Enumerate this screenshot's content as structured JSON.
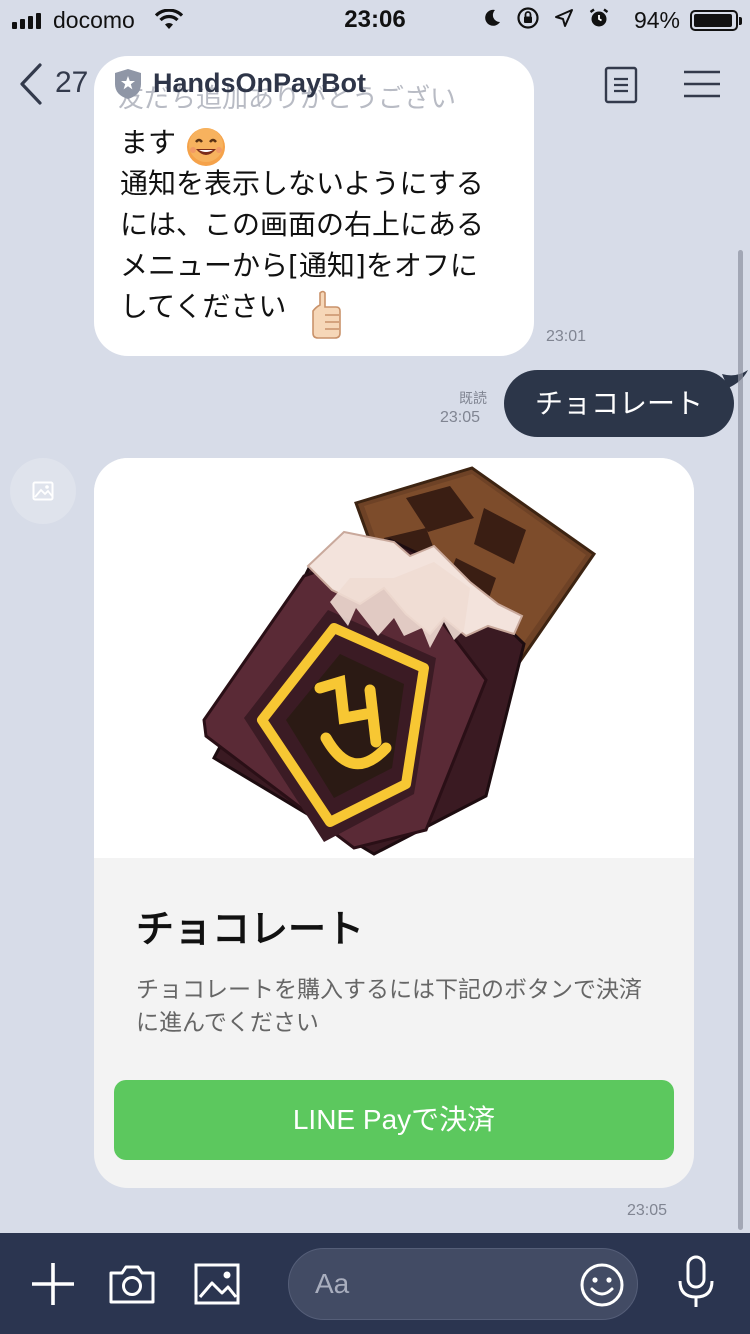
{
  "status_bar": {
    "carrier": "docomo",
    "time": "23:06",
    "battery_pct": "94%",
    "battery_level": 0.94
  },
  "header": {
    "unread_count": "27",
    "title": "HandsOnPayBot"
  },
  "messages": {
    "welcome": {
      "faded_line": "友だち追加ありがとうござい",
      "text": "ます\n通知を表示しないようにする\nには、この画面の右上にある\nメニューから[通知]をオフに\nしてください",
      "time": "23:01"
    },
    "outgoing": {
      "text": "チョコレート",
      "read_label": "既読",
      "time": "23:05"
    },
    "card": {
      "title": "チョコレート",
      "description": "チョコレートを購入するには下記のボタンで決済に進んでください",
      "button_label": "LINE Payで決済",
      "time": "23:05"
    }
  },
  "composer": {
    "placeholder": "Aa"
  },
  "colors": {
    "chat_bg": "#d7dce8",
    "outgoing_bubble": "#2c3649",
    "pay_button": "#5cc85e",
    "bottom_bar": "#2b3550"
  }
}
